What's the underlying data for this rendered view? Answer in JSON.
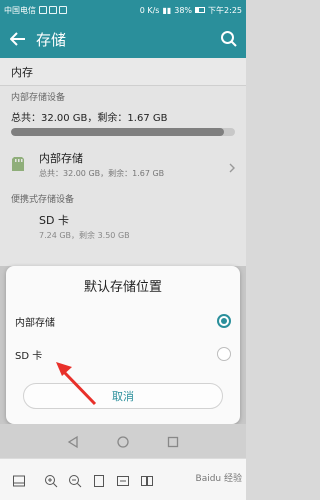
{
  "status_bar": {
    "carrier": "中国电信",
    "network_speed": "0 K/s",
    "battery_percent": "38%",
    "time": "下午2:25"
  },
  "app_bar": {
    "title": "存储"
  },
  "internal_row_label": "内存",
  "internal_device_header": "内部存储设备",
  "total_summary": "总共：32.00 GB，剩余：1.67 GB",
  "usage_fraction": 0.95,
  "internal_storage": {
    "name": "内部存储",
    "detail": "总共：32.00 GB，剩余：1.67 GB"
  },
  "portable_header": "便携式存储设备",
  "sd_card": {
    "name": "SD 卡",
    "detail_partial": "7.24 GB，剩余 3.50 GB"
  },
  "dialog": {
    "title": "默认存储位置",
    "options": [
      {
        "label": "内部存储",
        "selected": true
      },
      {
        "label": "SD 卡",
        "selected": false
      }
    ],
    "cancel_label": "取消"
  },
  "watermark": "Baidu 经验",
  "colors": {
    "accent": "#2a8f9b",
    "arrow": "#e8302a"
  },
  "icons": [
    "back-arrow-icon",
    "search-icon",
    "sd-card-icon",
    "chevron-right-icon",
    "triangle-back-icon",
    "circle-home-icon",
    "square-recents-icon",
    "save-icon",
    "zoom-in-icon",
    "zoom-out-icon",
    "page-icon",
    "fit-width-icon",
    "pages-icon"
  ]
}
